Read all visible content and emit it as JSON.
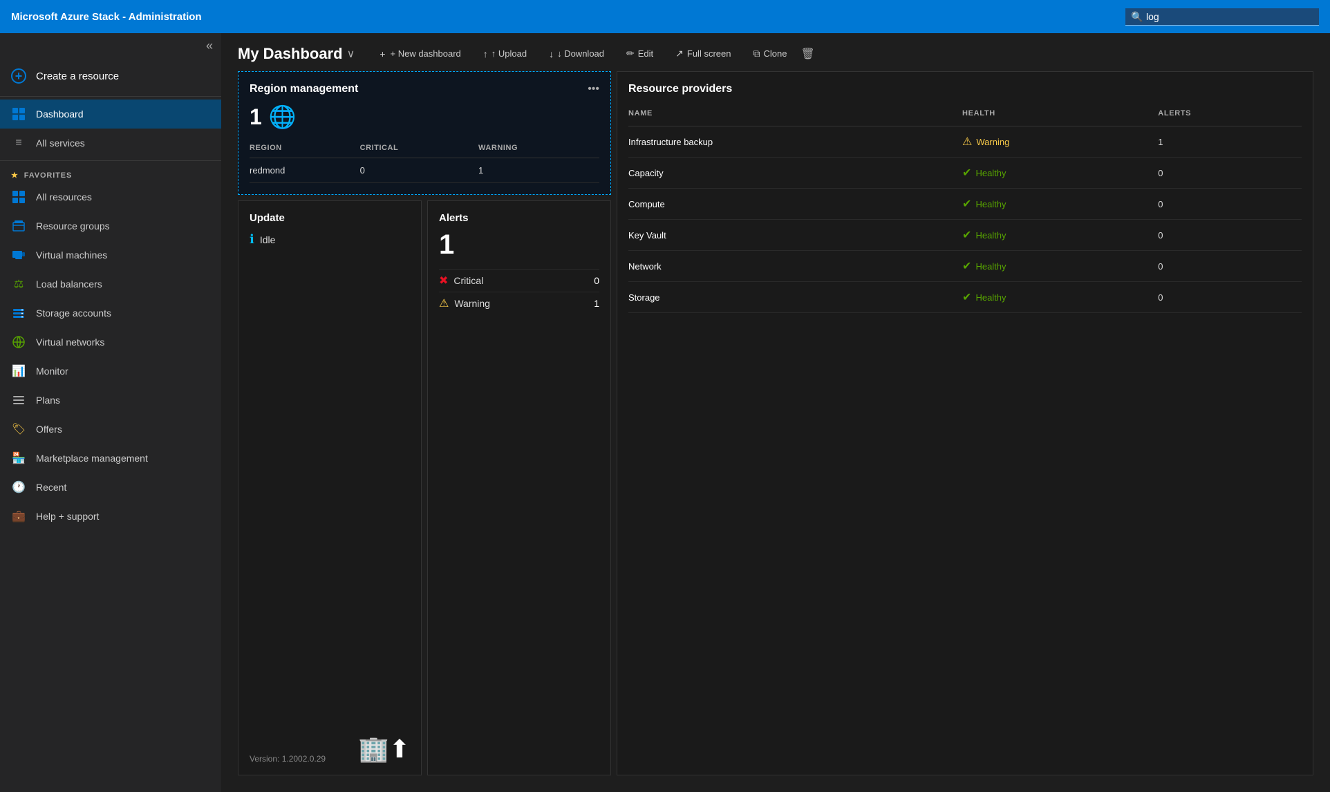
{
  "topbar": {
    "title": "Microsoft Azure Stack - Administration",
    "search_placeholder": "log",
    "search_value": "log"
  },
  "sidebar": {
    "collapse_icon": "«",
    "create_resource_label": "Create a resource",
    "nav_items": [
      {
        "id": "dashboard",
        "label": "Dashboard",
        "icon": "⊞",
        "active": true
      },
      {
        "id": "all-services",
        "label": "All services",
        "icon": "≡",
        "active": false
      }
    ],
    "favorites_label": "FAVORITES",
    "favorites_items": [
      {
        "id": "all-resources",
        "label": "All resources",
        "icon": "⊞"
      },
      {
        "id": "resource-groups",
        "label": "Resource groups",
        "icon": "🧊"
      },
      {
        "id": "virtual-machines",
        "label": "Virtual machines",
        "icon": "🖥"
      },
      {
        "id": "load-balancers",
        "label": "Load balancers",
        "icon": "⚖"
      },
      {
        "id": "storage-accounts",
        "label": "Storage accounts",
        "icon": "🗄"
      },
      {
        "id": "virtual-networks",
        "label": "Virtual networks",
        "icon": "🔗"
      },
      {
        "id": "monitor",
        "label": "Monitor",
        "icon": "📊"
      },
      {
        "id": "plans",
        "label": "Plans",
        "icon": "≡"
      },
      {
        "id": "offers",
        "label": "Offers",
        "icon": "🏷"
      },
      {
        "id": "marketplace-management",
        "label": "Marketplace management",
        "icon": "🏪"
      },
      {
        "id": "recent",
        "label": "Recent",
        "icon": "🕐"
      },
      {
        "id": "help-support",
        "label": "Help + support",
        "icon": "💼"
      }
    ]
  },
  "dashboard": {
    "title": "My Dashboard",
    "toolbar": {
      "new_dashboard": "+ New dashboard",
      "upload": "↑ Upload",
      "download": "↓ Download",
      "edit": "✏ Edit",
      "full_screen": "↗ Full screen",
      "clone": "⧉ Clone",
      "delete_icon": "🗑"
    },
    "region_panel": {
      "title": "Region management",
      "count": "1",
      "globe_icon": "🌐",
      "table_headers": [
        "REGION",
        "CRITICAL",
        "WARNING"
      ],
      "table_rows": [
        {
          "region": "redmond",
          "critical": "0",
          "warning": "1"
        }
      ]
    },
    "update_panel": {
      "title": "Update",
      "status_icon": "ℹ",
      "status": "Idle",
      "version_label": "Version: 1.2002.0.29",
      "graphic": "🏢⬆"
    },
    "alerts_panel": {
      "title": "Alerts",
      "count": "1",
      "rows": [
        {
          "icon": "❌",
          "label": "Critical",
          "value": "0"
        },
        {
          "icon": "⚠",
          "label": "Warning",
          "value": "1"
        }
      ]
    },
    "resource_providers": {
      "title": "Resource providers",
      "headers": [
        "NAME",
        "HEALTH",
        "ALERTS"
      ],
      "rows": [
        {
          "name": "Infrastructure backup",
          "health_icon": "⚠",
          "health_status": "warning",
          "health_label": "Warning",
          "alerts": "1"
        },
        {
          "name": "Capacity",
          "health_icon": "✅",
          "health_status": "healthy",
          "health_label": "Healthy",
          "alerts": "0"
        },
        {
          "name": "Compute",
          "health_icon": "✅",
          "health_status": "healthy",
          "health_label": "Healthy",
          "alerts": "0"
        },
        {
          "name": "Key Vault",
          "health_icon": "✅",
          "health_status": "healthy",
          "health_label": "Healthy",
          "alerts": "0"
        },
        {
          "name": "Network",
          "health_icon": "✅",
          "health_status": "healthy",
          "health_label": "Healthy",
          "alerts": "0"
        },
        {
          "name": "Storage",
          "health_icon": "✅",
          "health_status": "healthy",
          "health_label": "Healthy",
          "alerts": "0"
        }
      ]
    }
  }
}
